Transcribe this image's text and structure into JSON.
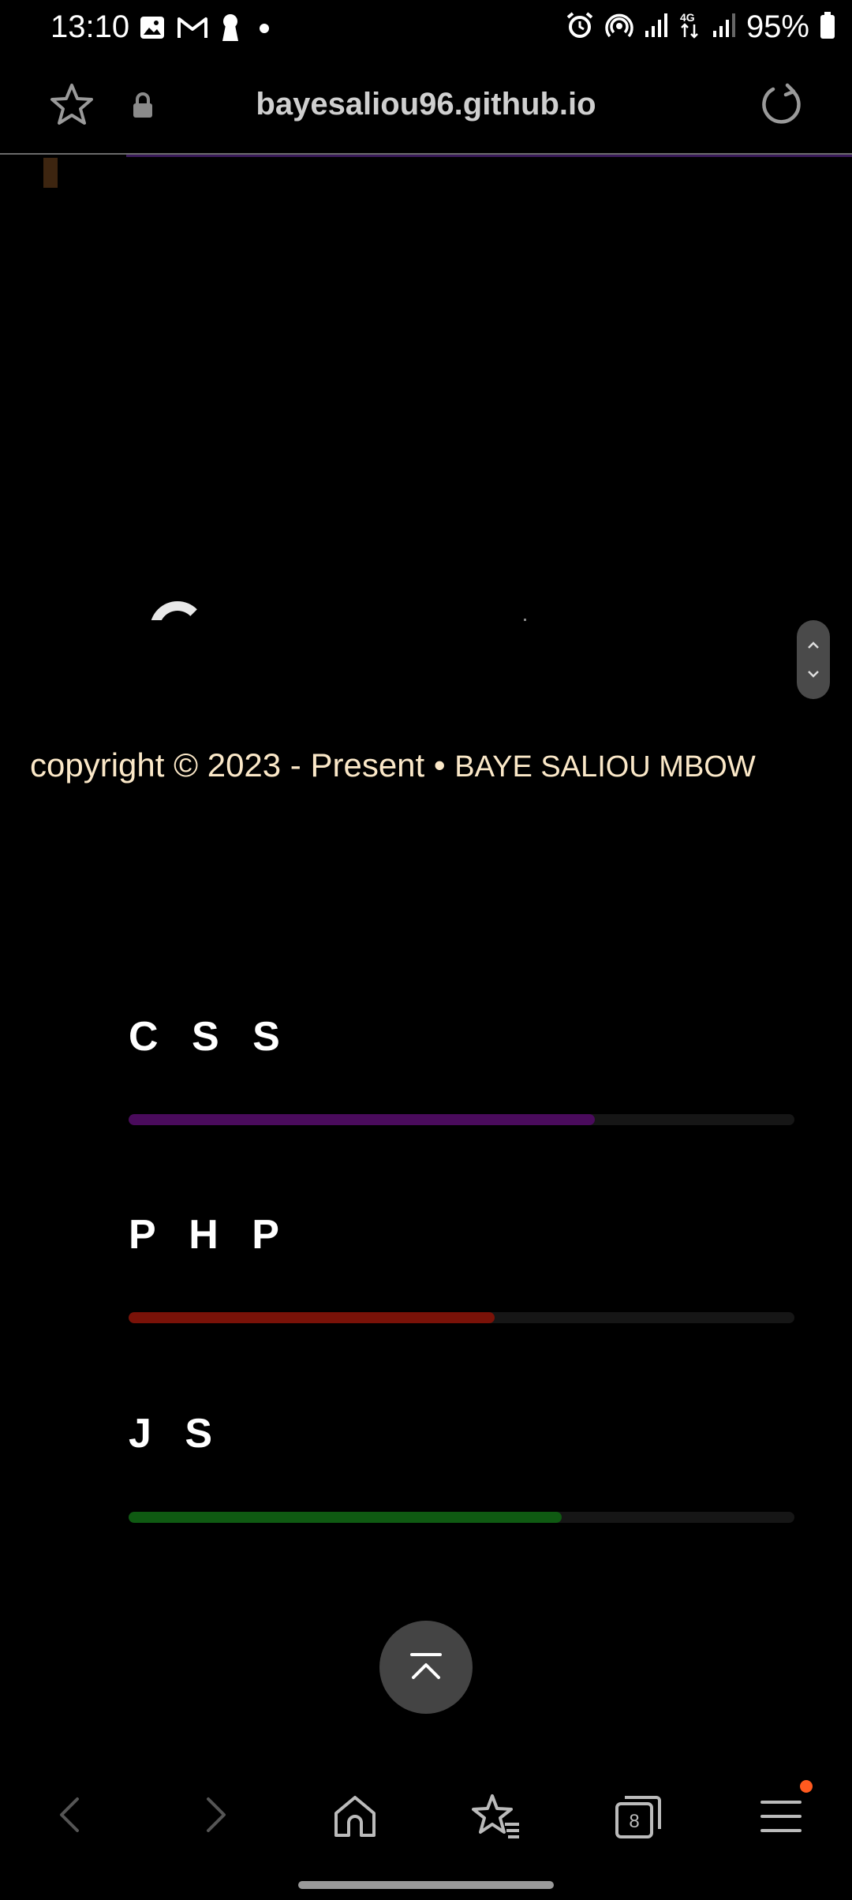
{
  "status_bar": {
    "time": "13:10",
    "battery": "95%",
    "left_icons": [
      "gallery-icon",
      "gmail-icon",
      "keyhole-icon",
      "dot-icon"
    ],
    "right_icons": [
      "alarm-icon",
      "hotspot-icon",
      "signal-icon",
      "4g-icon",
      "signal-icon",
      "battery-icon"
    ]
  },
  "browser": {
    "url": "bayesaliou96.github.io"
  },
  "footer": {
    "copyright": "copyright © 2023 - Present • ",
    "author": "BAYE SALIOU MBOW"
  },
  "skills": [
    {
      "label": "C S S",
      "level": 0.7,
      "color": "#4a0b5c"
    },
    {
      "label": "P H P",
      "level": 0.55,
      "color": "#7a1208"
    },
    {
      "label": "J S",
      "level": 0.65,
      "color": "#0f5a12"
    }
  ],
  "bottom_nav": {
    "tab_count": "8",
    "items": [
      "back-icon",
      "forward-icon",
      "home-icon",
      "bookmarks-icon",
      "tabs-icon",
      "menu-icon"
    ]
  },
  "colors": {
    "background": "#000000",
    "copyright_text": "#fbe8c8",
    "notification_dot": "#ff5a1f"
  }
}
